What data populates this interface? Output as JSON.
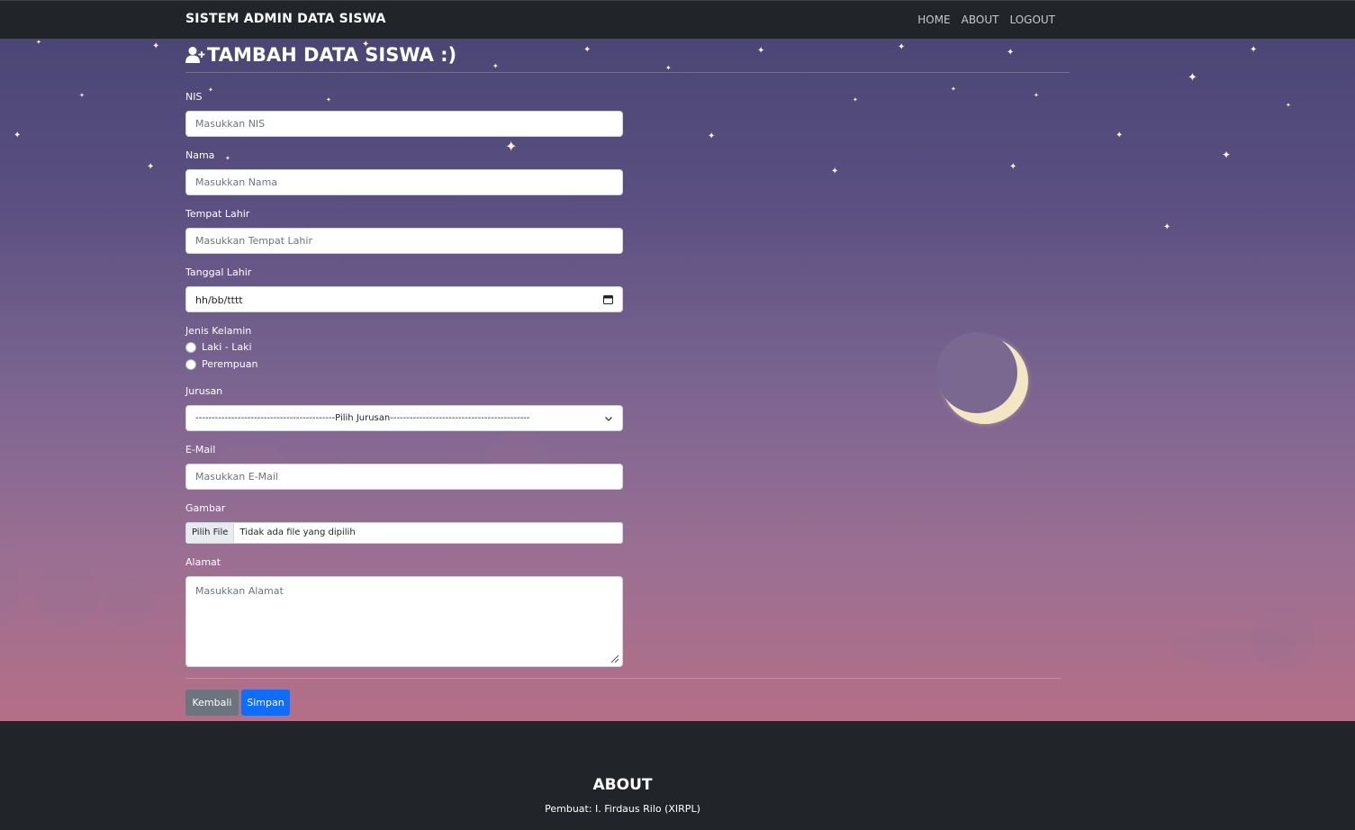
{
  "navbar": {
    "brand": "SISTEM ADMIN DATA SISWA",
    "links": [
      "HOME",
      "ABOUT",
      "LOGOUT"
    ]
  },
  "page": {
    "title": "TAMBAH DATA SISWA :)",
    "title_icon": "user-plus-icon"
  },
  "form": {
    "nis": {
      "label": "NIS",
      "placeholder": "Masukkan NIS"
    },
    "nama": {
      "label": "Nama",
      "placeholder": "Masukkan Nama"
    },
    "tempat_lahir": {
      "label": "Tempat Lahir",
      "placeholder": "Masukkan Tempat Lahir"
    },
    "tanggal_lahir": {
      "label": "Tanggal Lahir",
      "value": "hh/bb/tttt"
    },
    "jenis_kelamin": {
      "label": "Jenis Kelamin",
      "options": [
        "Laki - Laki",
        "Perempuan"
      ]
    },
    "jurusan": {
      "label": "Jurusan",
      "selected": "-------------------------------------------Pilih Jurusan-------------------------------------------"
    },
    "email": {
      "label": "E-Mail",
      "placeholder": "Masukkan E-Mail"
    },
    "gambar": {
      "label": "Gambar",
      "button": "Pilih File",
      "status": "Tidak ada file yang dipilih"
    },
    "alamat": {
      "label": "Alamat",
      "placeholder": "Masukkan Alamat"
    }
  },
  "buttons": {
    "back": "Kembali",
    "save": "Simpan"
  },
  "footer": {
    "title": "ABOUT",
    "text": "Pembuat: I. Firdaus Rilo (XIRPL)"
  },
  "colors": {
    "navbar": "#212529",
    "primary": "#0d6efd",
    "secondary": "#6c757d",
    "moon": "#f3e6c3"
  }
}
